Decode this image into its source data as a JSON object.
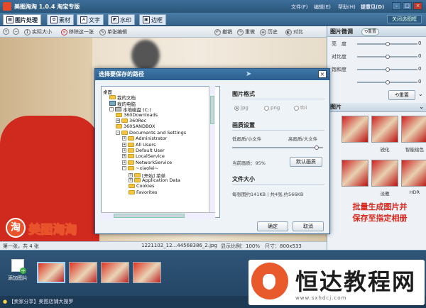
{
  "app": {
    "title": "美图淘淘 1.0.4 淘宝专版",
    "menu": [
      "文件(F)",
      "编辑(E)",
      "帮助(H)",
      "提意见(D)"
    ],
    "close_all": "关闭选图框"
  },
  "tabs": [
    {
      "label": "图片处理",
      "icon": "image-icon"
    },
    {
      "label": "素材",
      "icon": "material-icon"
    },
    {
      "label": "文字",
      "icon": "text-icon"
    },
    {
      "label": "水印",
      "icon": "watermark-icon"
    },
    {
      "label": "边框",
      "icon": "border-icon"
    }
  ],
  "toolbar": {
    "actual_size": "实际大小",
    "remove_one": "移除这一张",
    "single_edit": "单张编辑",
    "undo": "撤销",
    "redo": "重做",
    "history": "历史",
    "compare": "对比"
  },
  "canvas": {
    "brand": "美图淘淘",
    "brand_mark": "淘"
  },
  "statusbar": {
    "page": "第一张，共 4 张",
    "filename": "1221102_12...44568386_2.jpg",
    "scale": "显示比例：100%",
    "size": "尺寸：800x533"
  },
  "right_panel": {
    "adjust_title": "图片微调",
    "adjust_reset": "重置",
    "sliders": [
      {
        "label": "亮　度",
        "value": "0",
        "pos": 0.5
      },
      {
        "label": "对比度",
        "value": "0",
        "pos": 0.5
      },
      {
        "label": "饱和度",
        "value": "0",
        "pos": 0.5
      },
      {
        "label": "",
        "value": "0",
        "pos": 0.5
      }
    ],
    "reset_btn": "重置",
    "effects_title": "图片",
    "effects": [
      {
        "label": "",
        "row": 0
      },
      {
        "label": "锐化",
        "row": 0
      },
      {
        "label": "智能绘色",
        "row": 0
      },
      {
        "label": "",
        "row": 1
      },
      {
        "label": "淡雅",
        "row": 1
      },
      {
        "label": "HDR",
        "row": 1
      }
    ],
    "promo_line1": "批量生成图片并",
    "promo_line2": "保存至指定相册"
  },
  "dialog": {
    "title": "选择要保存的路径",
    "tree": [
      {
        "label": "桌面",
        "depth": 0,
        "icon": "desktop",
        "exp": ""
      },
      {
        "label": "我的文档",
        "depth": 1,
        "icon": "folder",
        "exp": ""
      },
      {
        "label": "我的电脑",
        "depth": 1,
        "icon": "pc",
        "exp": ""
      },
      {
        "label": "本地磁盘 (C:)",
        "depth": 1,
        "icon": "drive",
        "exp": "-"
      },
      {
        "label": "360Downloads",
        "depth": 2,
        "icon": "folder",
        "exp": ""
      },
      {
        "label": "360Rec",
        "depth": 2,
        "icon": "folder",
        "exp": "+"
      },
      {
        "label": "360SANDBOX",
        "depth": 2,
        "icon": "folder",
        "exp": ""
      },
      {
        "label": "Documents and Settings",
        "depth": 2,
        "icon": "folder",
        "exp": "-"
      },
      {
        "label": "Administrator",
        "depth": 3,
        "icon": "folder",
        "exp": "+"
      },
      {
        "label": "All Users",
        "depth": 3,
        "icon": "folder",
        "exp": "+"
      },
      {
        "label": "Default User",
        "depth": 3,
        "icon": "folder",
        "exp": "+"
      },
      {
        "label": "LocalService",
        "depth": 3,
        "icon": "folder",
        "exp": "+"
      },
      {
        "label": "NetworkService",
        "depth": 3,
        "icon": "folder",
        "exp": "+"
      },
      {
        "label": "~xiaolei~",
        "depth": 3,
        "icon": "folder",
        "exp": "-"
      },
      {
        "label": "[开始] 菜单",
        "depth": 4,
        "icon": "folder",
        "exp": "+"
      },
      {
        "label": "Application Data",
        "depth": 4,
        "icon": "folder",
        "exp": "+"
      },
      {
        "label": "Cookies",
        "depth": 4,
        "icon": "folder",
        "exp": ""
      },
      {
        "label": "Favorites",
        "depth": 4,
        "icon": "folder",
        "exp": ""
      }
    ],
    "format_title": "图片格式",
    "formats": [
      {
        "label": "jpg",
        "on": true
      },
      {
        "label": "png",
        "on": false
      },
      {
        "label": "tbi",
        "on": false
      }
    ],
    "quality_title": "画质设置",
    "quality_low": "低画质/小文件",
    "quality_high": "高画质/大文件",
    "quality_current": "当前画质：95%",
    "quality_default_btn": "默认画质",
    "size_title": "文件大小",
    "size_text": "每张图约141KB | 共4张,约566KB",
    "ok": "确定",
    "cancel": "取消"
  },
  "bottom": {
    "add_label": "添加图片",
    "thumb_count": 4
  },
  "footer": {
    "text": "【卖家分享】美图店铺大搜罗"
  },
  "watermark": {
    "title": "恒达教程网",
    "url": "www.sxhdcj.com"
  }
}
